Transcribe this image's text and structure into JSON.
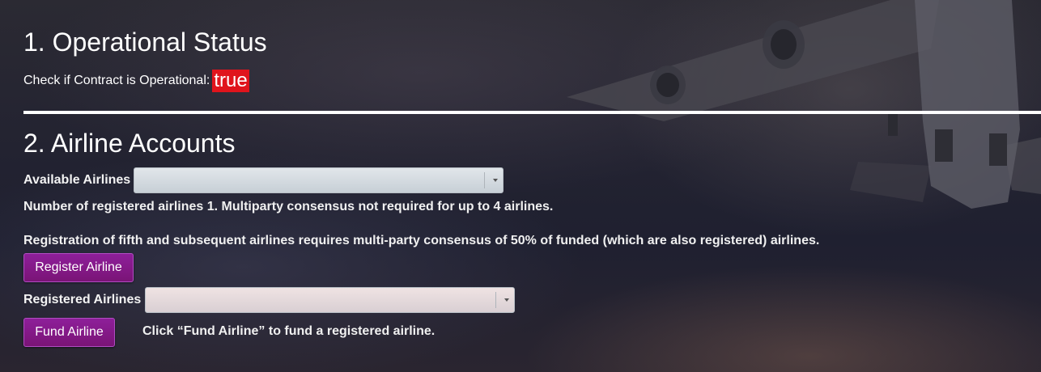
{
  "sections": {
    "operational": {
      "title": "1. Operational Status",
      "label": "Check if Contract is Operational:",
      "value": "true",
      "value_color": "#e0141c"
    },
    "airlines": {
      "title": "2. Airline Accounts",
      "available_label": "Available Airlines",
      "available_selected": "",
      "info_registered": "Number of registered airlines 1. Multiparty consensus not required for up to 4 airlines.",
      "info_consensus": "Registration of fifth and subsequent airlines requires multi-party consensus of 50% of funded (which are also registered) airlines.",
      "register_button": "Register Airline",
      "registered_label": "Registered Airlines",
      "registered_selected": "",
      "fund_button": "Fund Airline",
      "fund_hint": "Click “Fund Airline” to fund a registered airline."
    }
  },
  "colors": {
    "button_bg": "#8e1f9a",
    "divider": "#ffffff"
  },
  "icons": {
    "background": "airplane-background-image",
    "select_arrow": "chevron-down-icon"
  }
}
